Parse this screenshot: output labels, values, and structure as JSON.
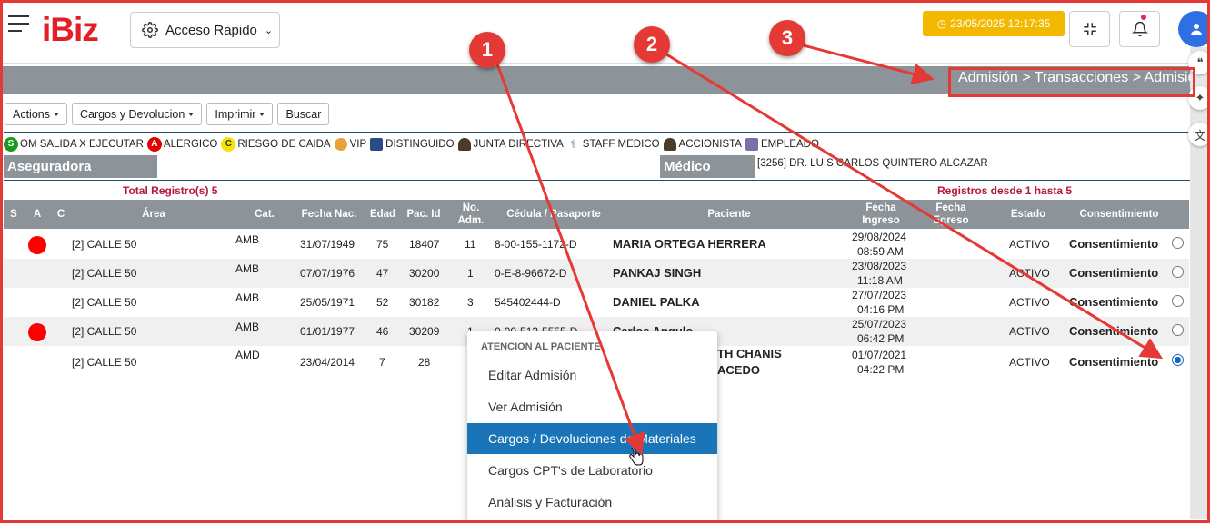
{
  "header": {
    "logo": "iBiz",
    "quick_access_label": "Acceso Rapido",
    "datetime": "23/05/2025 12:17:35"
  },
  "breadcrumb": "Admisión > Transacciones > Admisió",
  "toolbar": {
    "actions": "Actions",
    "cargos": "Cargos y Devolucion",
    "imprimir": "Imprimir",
    "buscar": "Buscar"
  },
  "legend": [
    {
      "badge": "S",
      "label": "OM SALIDA X EJECUTAR",
      "color": "#1b9a1b",
      "text_color": "#ffffff"
    },
    {
      "badge": "A",
      "label": "ALERGICO",
      "color": "#e00000",
      "text_color": "#ffffff"
    },
    {
      "badge": "C",
      "label": "RIESGO DE CAIDA",
      "color": "#f5e600",
      "text_color": "#333333"
    },
    {
      "icon": "person-icon",
      "label": "VIP"
    },
    {
      "icon": "id-card-icon",
      "label": "DISTINGUIDO"
    },
    {
      "icon": "person-suit-icon",
      "label": "JUNTA DIRECTIVA"
    },
    {
      "icon": "caduceus-icon",
      "label": "STAFF MEDICO"
    },
    {
      "icon": "person-suit-icon",
      "label": "ACCIONISTA"
    },
    {
      "icon": "badge-icon",
      "label": "EMPLEADO"
    }
  ],
  "info": {
    "aseguradora_label": "Aseguradora",
    "medico_label": "Médico",
    "medico_value": "[3256] DR. LUIS CARLOS QUINTERO ALCAZAR"
  },
  "summary": {
    "total": "Total Registro(s) 5",
    "range": "Registros desde 1 hasta 5"
  },
  "table": {
    "headers": {
      "s": "S",
      "a": "A",
      "c": "C",
      "area": "Área",
      "cat": "Cat.",
      "fecha_nac": "Fecha Nac.",
      "edad": "Edad",
      "pac_id": "Pac. Id",
      "no_adm_1": "No.",
      "no_adm_2": "Adm.",
      "cedula": "Cédula / Pasaporte",
      "paciente": "Paciente",
      "fecha_ingreso_1": "Fecha",
      "fecha_ingreso_2": "Ingreso",
      "fecha_egreso_1": "Fecha",
      "fecha_egreso_2": "Egreso",
      "estado": "Estado",
      "consentimiento": "Consentimiento"
    },
    "rows": [
      {
        "alert": true,
        "area": "[2] CALLE 50",
        "cat": "AMB",
        "fecha_nac": "31/07/1949",
        "edad": "75",
        "pac_id": "18407",
        "no_adm": "11",
        "cedula": "8-00-155-1172-D",
        "paciente": "MARIA ORTEGA HERRERA",
        "paciente_2": "",
        "ingreso_fecha": "29/08/2024",
        "ingreso_hora": "08:59 AM",
        "estado": "ACTIVO",
        "consentimiento": "Consentimiento",
        "selected": false
      },
      {
        "alert": false,
        "area": "[2] CALLE 50",
        "cat": "AMB",
        "fecha_nac": "07/07/1976",
        "edad": "47",
        "pac_id": "30200",
        "no_adm": "1",
        "cedula": "0-E-8-96672-D",
        "paciente": "PANKAJ SINGH",
        "paciente_2": "",
        "ingreso_fecha": "23/08/2023",
        "ingreso_hora": "11:18 AM",
        "estado": "ACTIVO",
        "consentimiento": "Consentimiento",
        "selected": false
      },
      {
        "alert": false,
        "area": "[2] CALLE 50",
        "cat": "AMB",
        "fecha_nac": "25/05/1971",
        "edad": "52",
        "pac_id": "30182",
        "no_adm": "3",
        "cedula": "545402444-D",
        "paciente": "DANIEL PALKA",
        "paciente_2": "",
        "ingreso_fecha": "27/07/2023",
        "ingreso_hora": "04:16 PM",
        "estado": "ACTIVO",
        "consentimiento": "Consentimiento",
        "selected": false
      },
      {
        "alert": true,
        "area": "[2] CALLE 50",
        "cat": "AMB",
        "fecha_nac": "01/01/1977",
        "edad": "46",
        "pac_id": "30209",
        "no_adm": "1",
        "cedula": "0-00-513-5555-D",
        "paciente": "Carlos Angulo",
        "paciente_2": "",
        "ingreso_fecha": "25/07/2023",
        "ingreso_hora": "06:42 PM",
        "estado": "ACTIVO",
        "consentimiento": "Consentimiento",
        "selected": false
      },
      {
        "alert": false,
        "area": "[2] CALLE 50",
        "cat": "AMD",
        "fecha_nac": "23/04/2014",
        "edad": "7",
        "pac_id": "28",
        "no_adm": "",
        "cedula": "",
        "paciente": "TH CHANIS",
        "paciente_2": "ACEDO",
        "ingreso_fecha": "01/07/2021",
        "ingreso_hora": "04:22 PM",
        "estado": "ACTIVO",
        "consentimiento": "Consentimiento",
        "selected": true
      }
    ]
  },
  "context_menu": {
    "heading": "ATENCION AL PACIENTE",
    "items": [
      "Editar Admisión",
      "Ver Admisión",
      "Cargos / Devoluciones de Materiales",
      "Cargos CPT's de Laboratorio",
      "Análisis y Facturación"
    ],
    "active_index": 2
  },
  "annotations": {
    "markers": [
      "1",
      "2",
      "3"
    ],
    "color": "#e53935"
  },
  "colors": {
    "brand": "#e31e24",
    "header_grey": "#8c9399",
    "datetime_bg": "#f3b800",
    "menu_active": "#1a74b8",
    "total_label": "#b5173c"
  }
}
